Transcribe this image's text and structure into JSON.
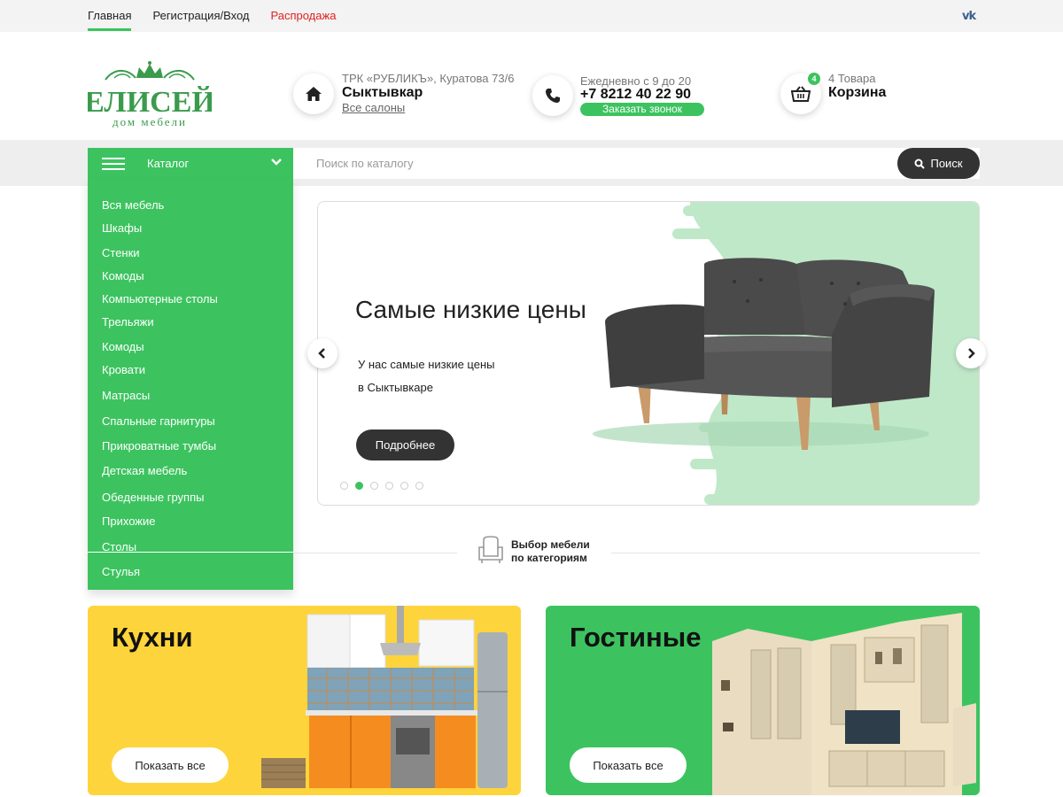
{
  "topnav": {
    "items": [
      {
        "label": "Главная",
        "active": true
      },
      {
        "label": "Регистрация/Вход",
        "active": false
      },
      {
        "label": "Распродажа",
        "active": false,
        "color": "#e02020"
      }
    ],
    "social": "vk"
  },
  "logo": {
    "name": "ЕЛИСЕЙ",
    "tagline": "дом мебели"
  },
  "header": {
    "location": {
      "address": "ТРК «РУБЛИКЪ», Куратова 73/6",
      "city": "Сыктывкар",
      "link": "Все салоны",
      "icon": "home-icon"
    },
    "phone": {
      "hours": "Ежедневно с 9 до 20",
      "number": "+7 8212 40 22 90",
      "callback": "Заказать звонок",
      "icon": "phone-icon"
    },
    "cart": {
      "count": "4",
      "summary": "4 Товара",
      "label": "Корзина",
      "icon": "basket-icon"
    }
  },
  "catalog": {
    "title": "Каталог",
    "items": [
      "Вся мебель",
      "Шкафы",
      "Стенки",
      "Комоды",
      "Компьютерные столы",
      "Трельяжи",
      "Комоды",
      "Кровати",
      "Матрасы",
      "Спальные гарнитуры",
      "Прикроватные тумбы",
      "Детская мебель",
      "Обеденные группы",
      "Прихожие",
      "Столы",
      "Стулья"
    ]
  },
  "search": {
    "placeholder": "Поиск по каталогу",
    "button": "Поиск"
  },
  "slider": {
    "title": "Самые низкие цены",
    "text_line1": "У нас самые низкие цены",
    "text_line2": "в Сыктывкаре",
    "button": "Подробнее",
    "slides_count": 6,
    "active_slide": 2
  },
  "section": {
    "label_line1": "Выбор мебели",
    "label_line2": "по категориям",
    "icon": "armchair-icon"
  },
  "cards": [
    {
      "title": "Кухни",
      "button": "Показать все",
      "color": "#fdd43b"
    },
    {
      "title": "Гостиные",
      "button": "Показать все",
      "color": "#3cc35f"
    }
  ],
  "colors": {
    "accent": "#3cc35f",
    "dark": "#333333",
    "sale": "#e02020",
    "kitchen_bg": "#fdd43b"
  }
}
